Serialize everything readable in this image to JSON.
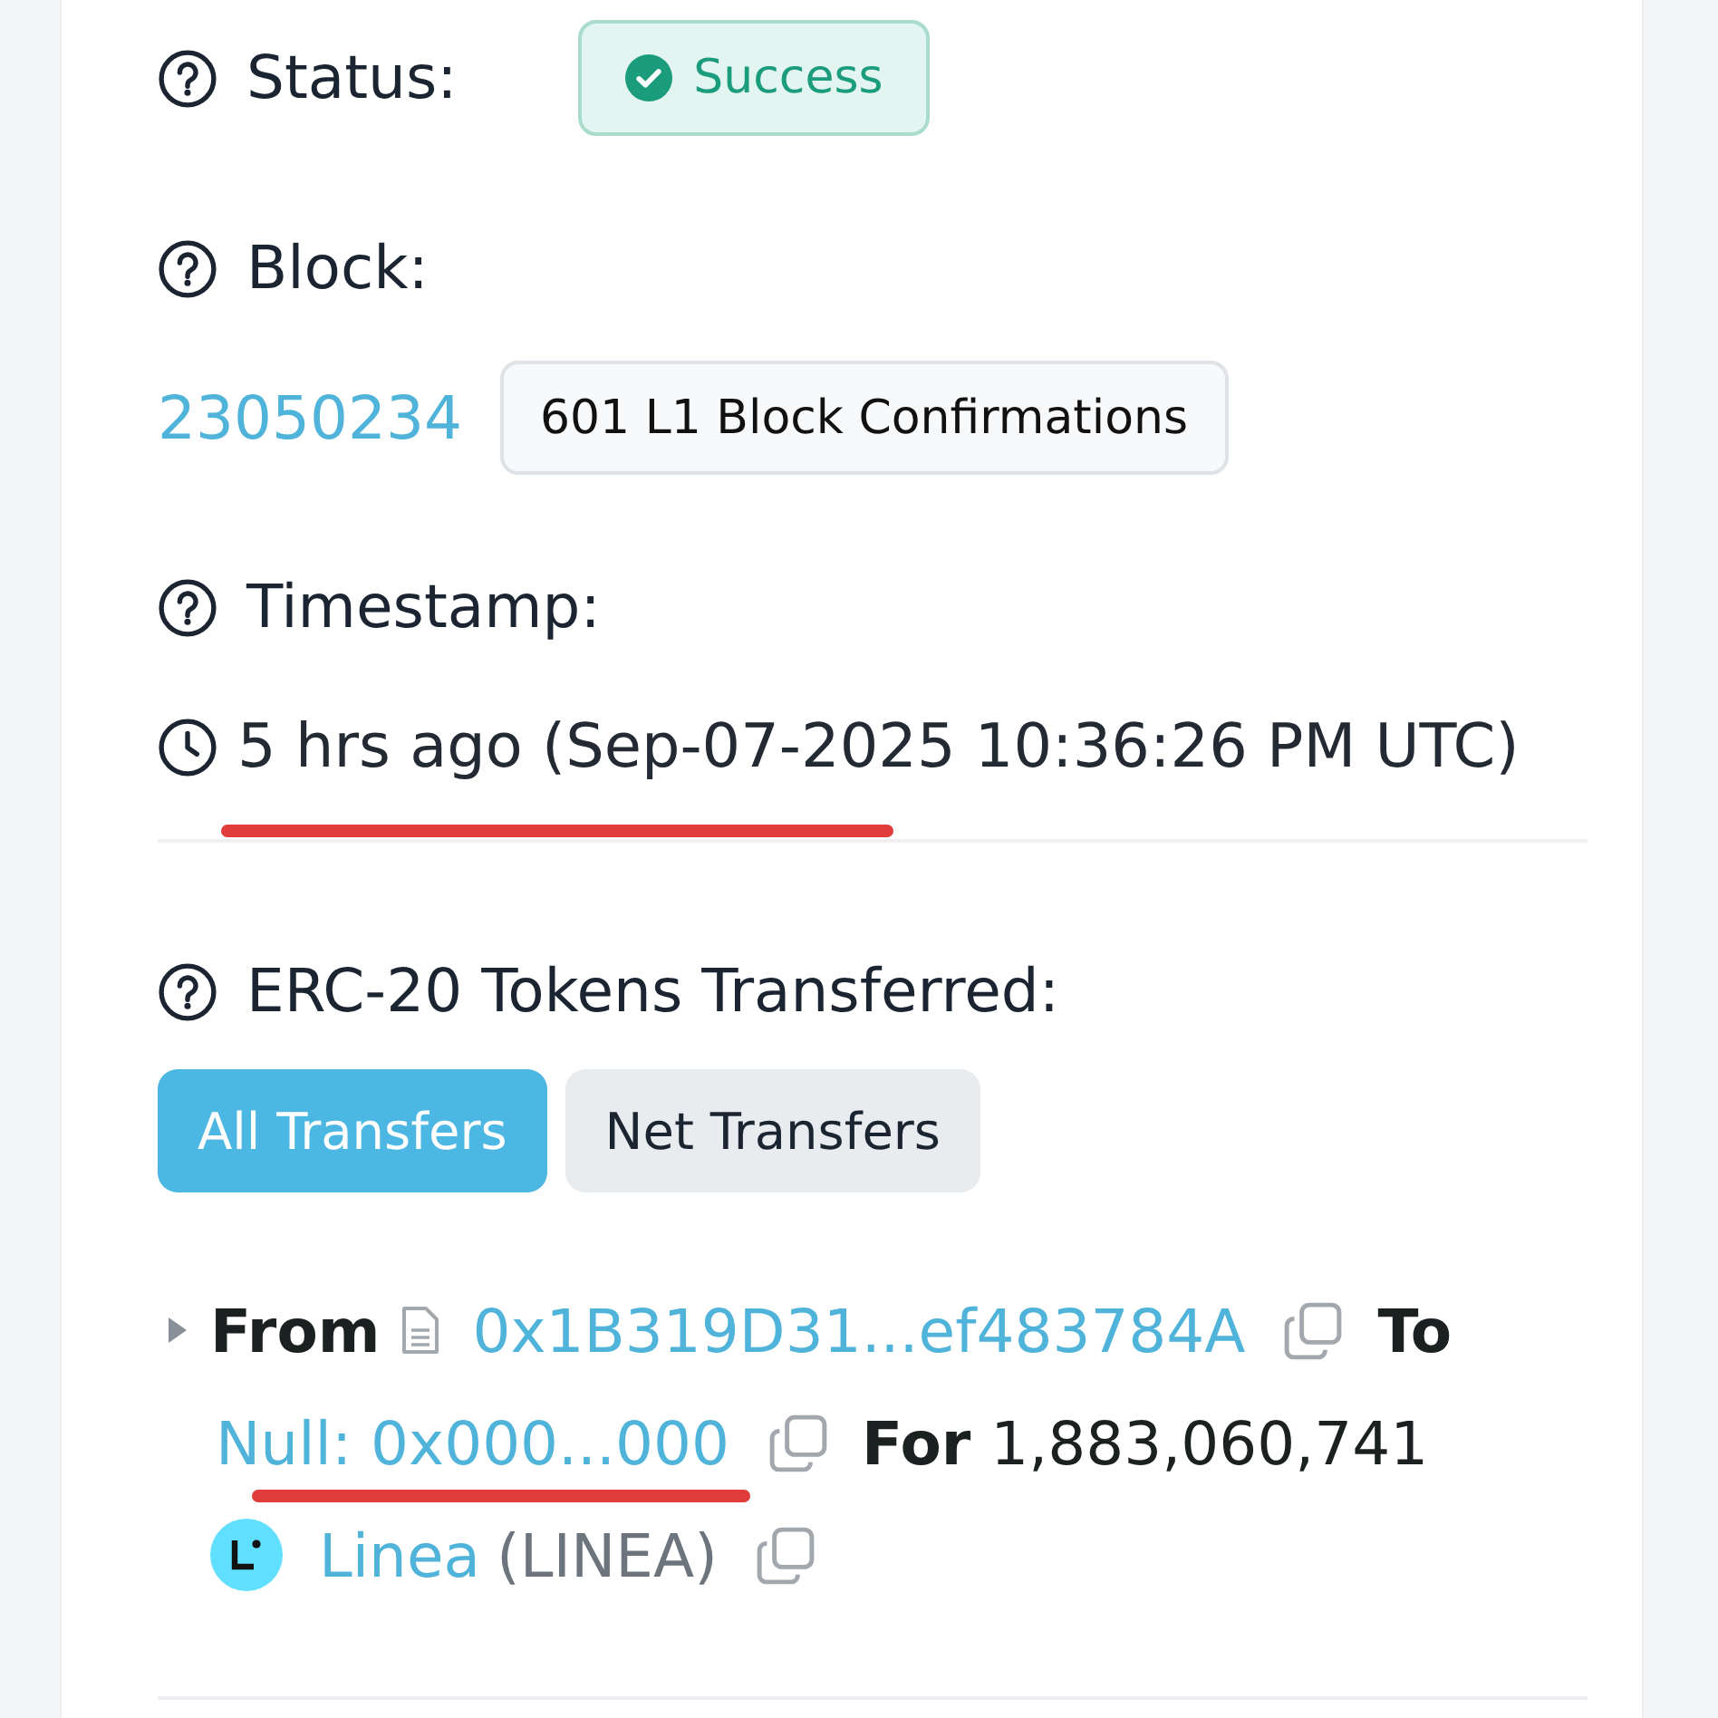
{
  "status": {
    "label": "Status:",
    "value": "Success",
    "kind": "success"
  },
  "block": {
    "label": "Block:",
    "number": "23050234",
    "confirmations": "601 L1 Block Confirmations"
  },
  "timestamp": {
    "label": "Timestamp:",
    "value": "5 hrs ago (Sep-07-2025 10:36:26 PM UTC)",
    "annotated": true
  },
  "tokens_transferred": {
    "label": "ERC-20 Tokens Transferred:",
    "tabs": [
      {
        "label": "All Transfers",
        "selected": true
      },
      {
        "label": "Net Transfers",
        "selected": false
      }
    ],
    "transfers": [
      {
        "expanded": false,
        "from_label": "From",
        "from": "0x1B319D31...ef483784A",
        "to_label": "To",
        "to": "Null: 0x000...000",
        "to_annotated": true,
        "for_label": "For",
        "amount": "1,883,060,741",
        "token_name": "Linea",
        "token_symbol": "(LINEA)"
      }
    ]
  }
}
